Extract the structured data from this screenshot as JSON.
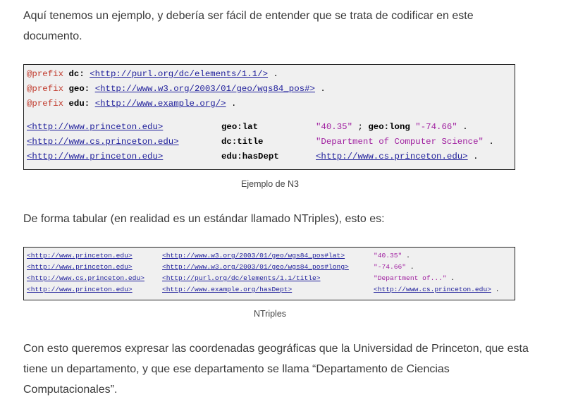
{
  "paragraphs": {
    "intro": "Aquí tenemos un ejemplo, y debería ser fácil de entender que se trata de codificar en este documento.",
    "tabular": "De forma tabular (en realidad es un estándar llamado NTriples), esto es:",
    "conclusion": "Con esto queremos expresar las coordenadas geográficas que la Universidad de Princeton, que esta tiene un departamento, y que ese departamento se llama “Departamento de Ciencias Computacionales”."
  },
  "n3_block": {
    "caption": "Ejemplo de N3",
    "prefixes": [
      {
        "keyword": "@prefix",
        "name": "dc:",
        "uri": "<http://purl.org/dc/elements/1.1/>",
        "end": " ."
      },
      {
        "keyword": "@prefix",
        "name": "geo:",
        "uri": "<http://www.w3.org/2003/01/geo/wgs84_pos#>",
        "end": " ."
      },
      {
        "keyword": "@prefix",
        "name": "edu:",
        "uri": "<http://www.example.org/>",
        "end": " ."
      }
    ],
    "triples": [
      {
        "subject": "<http://www.princeton.edu>",
        "predicate": "geo:lat",
        "object": "\"40.35\"",
        "extra_sep": " ; ",
        "extra_pred": "geo:long",
        "extra_obj": " \"-74.66\"",
        "end": " ."
      },
      {
        "subject": "<http://www.cs.princeton.edu>",
        "predicate": "dc:title",
        "object": "\"Department of Computer Science\"",
        "extra_sep": "",
        "extra_pred": "",
        "extra_obj": "",
        "end": " ."
      },
      {
        "subject": "<http://www.princeton.edu>",
        "predicate": "edu:hasDept",
        "object_uri": "<http://www.cs.princeton.edu>",
        "end": " ."
      }
    ]
  },
  "ntriples_block": {
    "caption": "NTriples",
    "rows": [
      {
        "subject": "<http://www.princeton.edu>",
        "predicate": "<http://www.w3.org/2003/01/geo/wgs84_pos#lat>",
        "object": "\"40.35\"",
        "end": " ."
      },
      {
        "subject": "<http://www.princeton.edu>",
        "predicate": "<http://www.w3.org/2003/01/geo/wgs84_pos#long>",
        "object": "\"-74.66\"",
        "end": " ."
      },
      {
        "subject": "<http://www.cs.princeton.edu>",
        "predicate": "<http://purl.org/dc/elements/1.1/title>",
        "object": "\"Department of...\"",
        "end": " ."
      },
      {
        "subject": "<http://www.princeton.edu>",
        "predicate": "<http://www.example.org/hasDept>",
        "object_uri": "<http://www.cs.princeton.edu>",
        "end": " ."
      }
    ]
  },
  "colors": {
    "keyword": "#c0392b",
    "uri": "#1d1d9a",
    "string": "#a020a0",
    "code_background": "#f0f0f0"
  }
}
